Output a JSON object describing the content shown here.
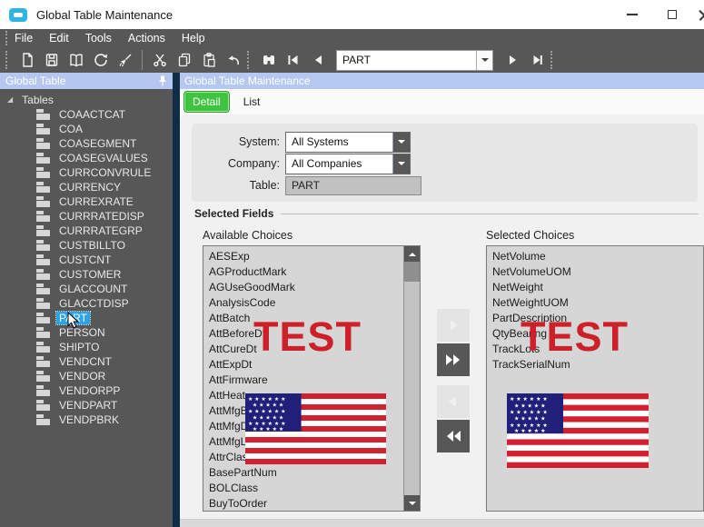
{
  "window": {
    "title": "Global Table Maintenance"
  },
  "menu": {
    "items": [
      "File",
      "Edit",
      "Tools",
      "Actions",
      "Help"
    ]
  },
  "toolbar": {
    "record_selector": {
      "value": "PART"
    },
    "icons": [
      "new",
      "save",
      "open-book",
      "refresh",
      "clean",
      "cut",
      "copy",
      "paste",
      "undo",
      "find",
      "first-record",
      "previous-record",
      "next-record",
      "last-record"
    ]
  },
  "sidebar": {
    "header_title": "Global Table",
    "root_label": "Tables",
    "selected_table": "PART",
    "tables": [
      "COAACTCAT",
      "COA",
      "COASEGMENT",
      "COASEGVALUES",
      "CURRCONVRULE",
      "CURRENCY",
      "CURREXRATE",
      "CURRRATEDISP",
      "CURRRATEGRP",
      "CUSTBILLTO",
      "CUSTCNT",
      "CUSTOMER",
      "GLACCOUNT",
      "GLACCTDISP",
      "PART",
      "PERSON",
      "SHIPTO",
      "VENDCNT",
      "VENDOR",
      "VENDORPP",
      "VENDPART",
      "VENDPBRK"
    ]
  },
  "main": {
    "header_title": "Global Table Maintenance",
    "tabs": {
      "detail": "Detail",
      "list": "List"
    },
    "form": {
      "system_label": "System:",
      "system_value": "All Systems",
      "company_label": "Company:",
      "company_value": "All Companies",
      "table_label": "Table:",
      "table_value": "PART"
    },
    "selected_fields": {
      "title": "Selected Fields",
      "available_label": "Available Choices",
      "selected_label": "Selected Choices",
      "available_items": [
        "AESExp",
        "AGProductMark",
        "AGUseGoodMark",
        "AnalysisCode",
        "AttBatch",
        "AttBeforeDt",
        "AttCureDt",
        "AttExpDt",
        "AttFirmware",
        "AttHeat",
        "AttMfgBatch",
        "AttMfgDt",
        "AttMfgLot",
        "AttrClassID",
        "BasePartNum",
        "BOLClass",
        "BuyToOrder"
      ],
      "selected_items": [
        "NetVolume",
        "NetVolumeUOM",
        "NetWeight",
        "NetWeightUOM",
        "PartDescription",
        "QtyBearing",
        "TrackLots",
        "TrackSerialNum"
      ]
    }
  },
  "watermark": {
    "text": "TEST",
    "color": "#ce2029"
  },
  "colors": {
    "chrome_dark": "#575757",
    "panel_header_blue": "#b5c6f0",
    "selection_blue": "#2aa3ea",
    "active_tab_green": "#3ec43e",
    "watermark_red": "#ce2029",
    "flag_red": "#d22030",
    "flag_blue": "#20207a"
  }
}
